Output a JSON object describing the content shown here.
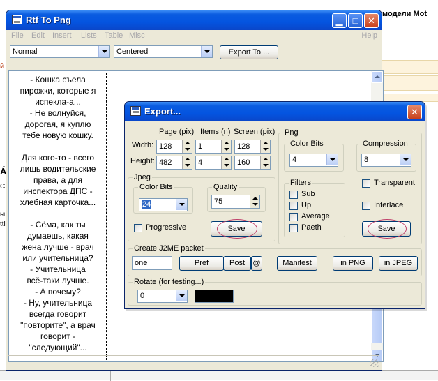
{
  "background": {
    "top_right_text": "модели Mot",
    "left_fragments": [
      "Á",
      "С",
      "ы",
      "ttl",
      "й"
    ]
  },
  "main_window": {
    "title": "Rtf To Png",
    "menu": [
      "File",
      "Edit",
      "Insert",
      "Lists",
      "Table",
      "Misc"
    ],
    "help_label": "Help",
    "style_value": "Normal",
    "align_value": "Centered",
    "export_button": "Export To ...",
    "editor_lines": [
      "- Кошка съела",
      "пирожки, которые я",
      "испекла-а...",
      "- Не волнуйся,",
      "дорогая, я куплю",
      "тебе новую кошку.",
      "",
      "Для кого-то - всего",
      "лишь водительские",
      "права, а для",
      "инспектора ДПС -",
      "хлебная карточка...",
      "",
      "- Сёма, как ты",
      "думаешь, какая",
      "жена лучше - врач",
      "или учительница?",
      "- Учительница",
      "всё-таки лучше.",
      "- А почему?",
      "- Ну, учительница",
      "всегда говорит",
      "\"повторите\", а врач",
      "говорит -",
      "\"следующий\"..."
    ]
  },
  "export_dialog": {
    "title": "Export...",
    "size": {
      "col_page": "Page (pix)",
      "col_items": "Items (n)",
      "col_screen": "Screen (pix)",
      "width_label": "Width:",
      "height_label": "Height:",
      "page_width": "128",
      "items_width": "1",
      "screen_width": "128",
      "page_height": "482",
      "items_height": "4",
      "screen_height": "160"
    },
    "jpeg": {
      "legend": "Jpeg",
      "color_bits_legend": "Color Bits",
      "color_bits_value": "24",
      "quality_legend": "Quality",
      "quality_value": "75",
      "progressive_label": "Progressive",
      "save_label": "Save"
    },
    "png": {
      "legend": "Png",
      "color_bits_legend": "Color Bits",
      "color_bits_value": "4",
      "compression_legend": "Compression",
      "compression_value": "8",
      "filters_legend": "Filters",
      "filters": [
        "Sub",
        "Up",
        "Average",
        "Paeth"
      ],
      "transparent_label": "Transparent",
      "interlace_label": "Interlace",
      "save_label": "Save"
    },
    "j2me": {
      "legend": "Create J2ME packet",
      "name_value": "one",
      "pref_label": "Pref",
      "post_label": "Post",
      "at_label": "@",
      "manifest_label": "Manifest",
      "in_png_label": "in PNG",
      "in_jpeg_label": "in JPEG"
    },
    "rotate": {
      "legend": "Rotate (for testing...)",
      "value": "0",
      "color_swatch": "#000000"
    }
  }
}
